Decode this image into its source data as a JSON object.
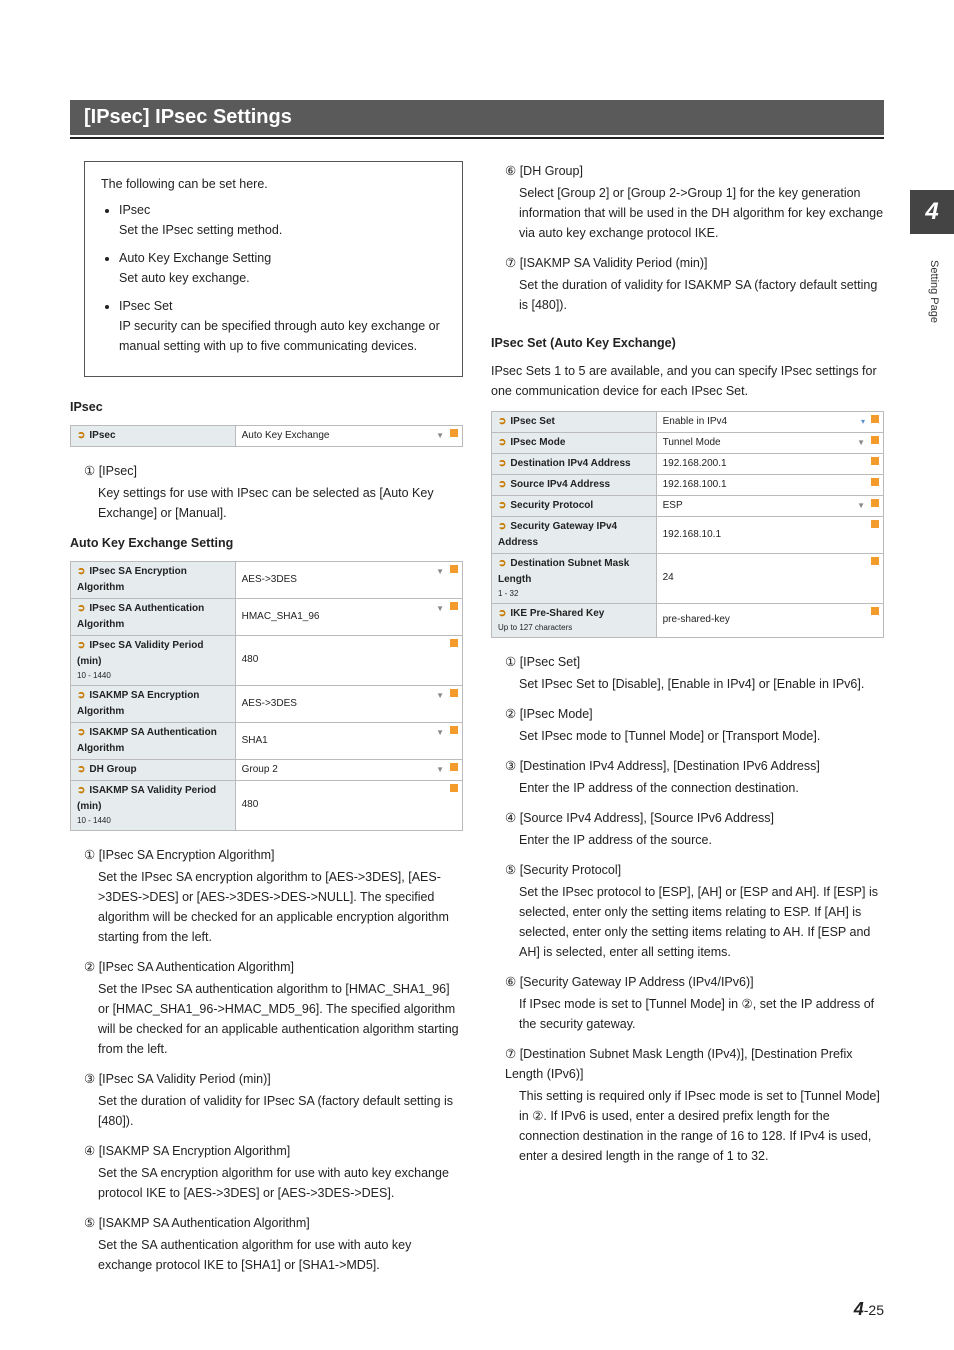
{
  "page": {
    "title": "[IPsec] IPsec Settings",
    "chapter": "4",
    "side_label": "Setting Page",
    "footer_chapter": "4",
    "footer_page": "-25"
  },
  "intro": {
    "lead": "The following can be set here.",
    "items": [
      {
        "name": "IPsec",
        "desc": "Set the IPsec setting method."
      },
      {
        "name": "Auto Key Exchange Setting",
        "desc": "Set auto key exchange."
      },
      {
        "name": "IPsec Set",
        "desc": "IP security can be specified through auto key exchange or manual setting with up to five communicating devices."
      }
    ]
  },
  "ipsec_section": {
    "heading": "IPsec",
    "row": {
      "label": "IPsec",
      "value": "Auto Key Exchange"
    },
    "item1_num": "①",
    "item1_name": "[IPsec]",
    "item1_body": "Key settings for use with IPsec can be selected as [Auto Key Exchange] or [Manual]."
  },
  "ake_section": {
    "heading": "Auto Key Exchange Setting",
    "rows": [
      {
        "label": "IPsec SA Encryption Algorithm",
        "value": "AES->3DES"
      },
      {
        "label": "IPsec SA Authentication Algorithm",
        "value": "HMAC_SHA1_96"
      },
      {
        "label": "IPsec SA Validity Period (min)",
        "sub": "10 - 1440",
        "value": "480"
      },
      {
        "label": "ISAKMP SA Encryption Algorithm",
        "value": "AES->3DES"
      },
      {
        "label": "ISAKMP SA Authentication Algorithm",
        "value": "SHA1"
      },
      {
        "label": "DH Group",
        "value": "Group 2"
      },
      {
        "label": "ISAKMP SA Validity Period (min)",
        "sub": "10 - 1440",
        "value": "480"
      }
    ],
    "items": [
      {
        "num": "①",
        "name": "[IPsec SA Encryption Algorithm]",
        "body": "Set the IPsec SA encryption algorithm to [AES->3DES], [AES->3DES->DES] or [AES->3DES->DES->NULL]. The specified algorithm will be checked for an applicable encryption algorithm starting from the left."
      },
      {
        "num": "②",
        "name": "[IPsec SA Authentication Algorithm]",
        "body": "Set the IPsec SA authentication algorithm to [HMAC_SHA1_96] or [HMAC_SHA1_96->HMAC_MD5_96]. The specified algorithm will be checked for an applicable authentication algorithm starting from the left."
      },
      {
        "num": "③",
        "name": "[IPsec SA Validity Period (min)]",
        "body": "Set the duration of validity for IPsec SA (factory default setting is [480])."
      },
      {
        "num": "④",
        "name": "[ISAKMP SA Encryption Algorithm]",
        "body": "Set the SA encryption algorithm for use with auto key exchange protocol IKE to [AES->3DES] or [AES->3DES->DES]."
      },
      {
        "num": "⑤",
        "name": "[ISAKMP SA Authentication Algorithm]",
        "body": "Set the SA authentication algorithm for use with auto key exchange protocol IKE to [SHA1] or [SHA1->MD5]."
      }
    ]
  },
  "right_items_top": [
    {
      "num": "⑥",
      "name": "[DH Group]",
      "body": "Select [Group 2] or [Group 2->Group 1] for the key generation information that will be used in the DH algorithm for key exchange via auto key exchange protocol IKE."
    },
    {
      "num": "⑦",
      "name": "[ISAKMP SA Validity Period (min)]",
      "body": "Set the duration of validity for ISAKMP SA (factory default setting is [480])."
    }
  ],
  "ipsec_set": {
    "heading": "IPsec Set (Auto Key Exchange)",
    "intro": "IPsec Sets 1 to 5 are available, and you can specify IPsec settings for one communication device for each IPsec Set.",
    "rows": [
      {
        "label": "IPsec Set",
        "value": "Enable in IPv4"
      },
      {
        "label": "IPsec Mode",
        "value": "Tunnel Mode"
      },
      {
        "label": "Destination IPv4 Address",
        "value": "192.168.200.1"
      },
      {
        "label": "Source IPv4 Address",
        "value": "192.168.100.1"
      },
      {
        "label": "Security Protocol",
        "value": "ESP"
      },
      {
        "label": "Security Gateway IPv4 Address",
        "value": "192.168.10.1"
      },
      {
        "label": "Destination Subnet Mask Length",
        "sub": "1 - 32",
        "value": "24"
      },
      {
        "label": "IKE Pre-Shared Key",
        "sub": "Up to 127 characters",
        "value": "pre-shared-key"
      }
    ],
    "items": [
      {
        "num": "①",
        "name": "[IPsec Set]",
        "body": "Set IPsec Set to [Disable], [Enable in IPv4] or [Enable in IPv6]."
      },
      {
        "num": "②",
        "name": "[IPsec Mode]",
        "body": "Set IPsec mode to [Tunnel Mode] or [Transport Mode]."
      },
      {
        "num": "③",
        "name": "[Destination IPv4 Address], [Destination IPv6 Address]",
        "body": "Enter the IP address of the connection destination."
      },
      {
        "num": "④",
        "name": "[Source IPv4 Address], [Source IPv6 Address]",
        "body": "Enter the IP address of the source."
      },
      {
        "num": "⑤",
        "name": "[Security Protocol]",
        "body": "Set the IPsec protocol to [ESP], [AH] or [ESP and AH]. If [ESP] is selected, enter only the setting items relating to ESP. If [AH] is selected, enter only the setting items relating to AH. If [ESP and AH] is selected, enter all setting items."
      },
      {
        "num": "⑥",
        "name": "[Security Gateway IP Address (IPv4/IPv6)]",
        "body": "If IPsec mode is set to [Tunnel Mode] in ②, set the IP address of the security gateway."
      },
      {
        "num": "⑦",
        "name": "[Destination Subnet Mask Length (IPv4)], [Destination Prefix Length (IPv6)]",
        "body": "This setting is required only if IPsec mode is set to [Tunnel Mode] in ②. If IPv6 is used, enter a desired prefix length for the connection destination in the range of 16 to 128. If IPv4 is used, enter a desired length in the range of 1 to 32."
      }
    ]
  }
}
